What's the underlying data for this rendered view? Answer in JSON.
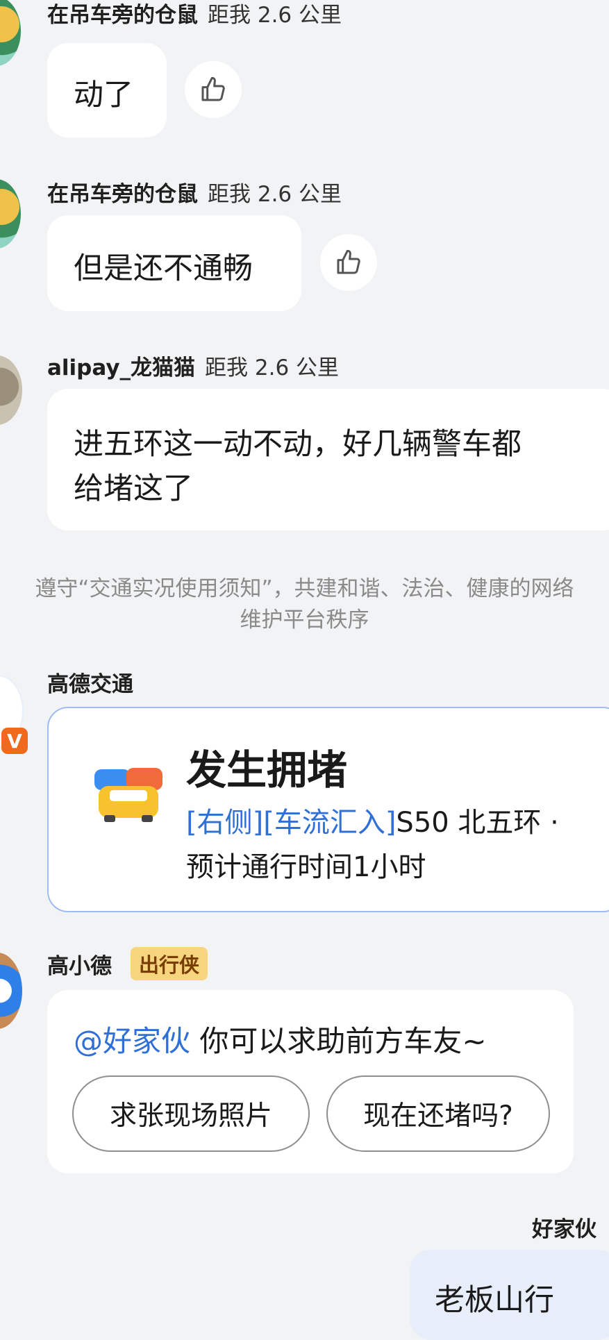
{
  "messages": [
    {
      "user": "在吊车旁的仓鼠",
      "distance": "距我 2.6 公里",
      "text": "动了"
    },
    {
      "user": "在吊车旁的仓鼠",
      "distance": "距我 2.6 公里",
      "text": "但是还不通畅"
    },
    {
      "user": "alipay_龙猫猫",
      "distance": "距我 2.6 公里",
      "text_line1": "进五环这一动不动，好几辆警车都",
      "text_line2": "给堵这了"
    }
  ],
  "notice": {
    "line1": "遵守“交通实况使用须知”，共建和谐、法治、健康的网络",
    "line2": "维护平台秩序"
  },
  "traffic": {
    "sender": "高德交通",
    "badge": "V",
    "title": "发生拥堵",
    "tags": "[右侧][车流汇入]",
    "road": "S50 北五环 ·",
    "eta": "预计通行时间1小时"
  },
  "assistant": {
    "sender": "高小德",
    "badge": "出行侠",
    "mention": "@好家伙",
    "text": " 你可以求助前方车友~",
    "actions": [
      "求张现场照片",
      "现在还堵吗?"
    ]
  },
  "self": {
    "name": "好家伙",
    "text": "老板山行"
  },
  "colors": {
    "background": "#f2f3f5",
    "accent": "#2f6fd6",
    "badge_bg": "#f7d57e",
    "verified": "#f06a1d"
  },
  "icons": [
    "thumbs-up-icon",
    "car-congestion-icon",
    "verified-badge-icon"
  ]
}
